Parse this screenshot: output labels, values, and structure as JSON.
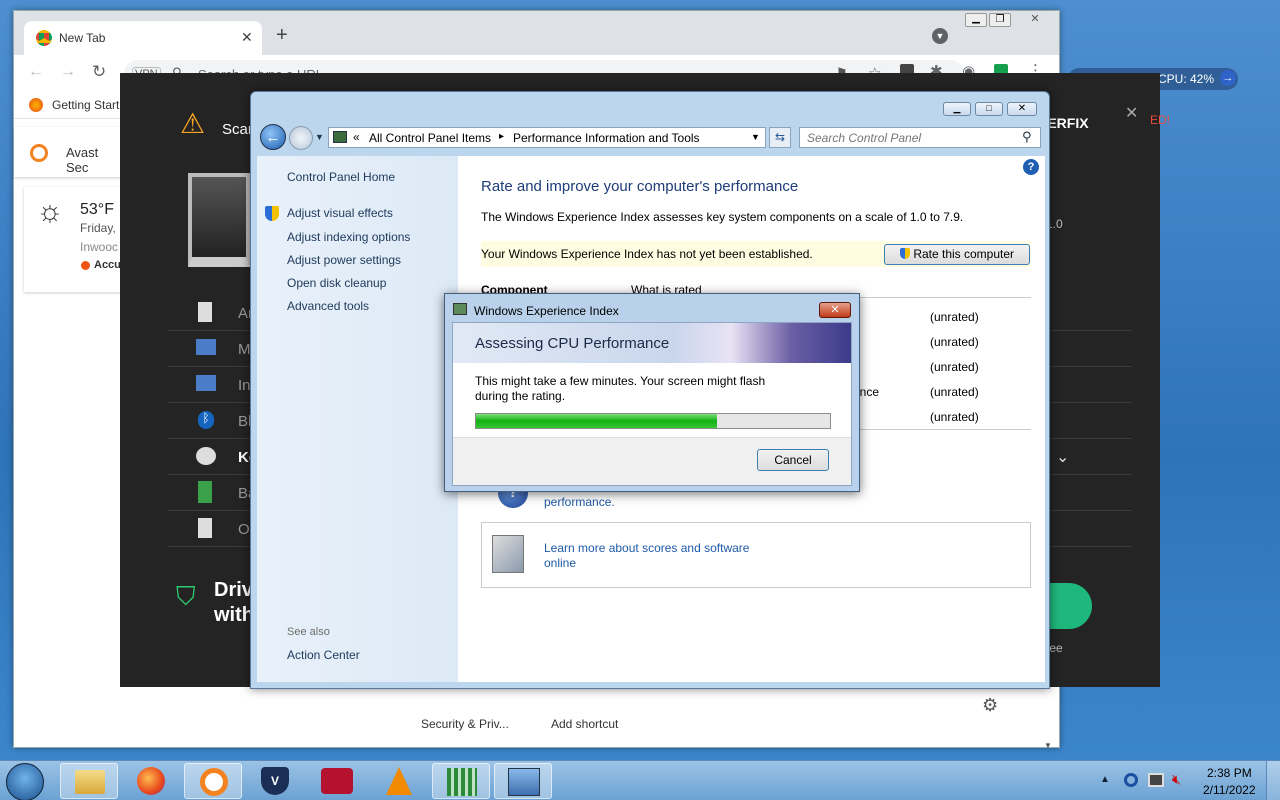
{
  "chrome": {
    "tab_title": "New Tab",
    "new_tab": "+",
    "vpn": "VPN",
    "address_placeholder": "Search or type a URL",
    "bookmark_1": "Getting Start",
    "avast_sec": "Avast Sec",
    "weather": {
      "temp": "53°F",
      "day": "Friday,",
      "city": "Inwooc",
      "source": "AccuW"
    },
    "shortcuts": [
      "Security & Priv...",
      "Add shortcut"
    ],
    "cpu": "CPU: 42%"
  },
  "avast": {
    "scan": "Scan",
    "brand": "VERFIX",
    "rows": [
      "Ar",
      "M",
      "In",
      "Bl",
      "Ke",
      "Ba",
      "O"
    ],
    "drivers_line1": "Driv",
    "drivers_line2": "with",
    "version": "1.0",
    "guarantee": "tee",
    "badge": "ED!"
  },
  "cp": {
    "breadcrumb_root": "All Control Panel Items",
    "breadcrumb_sep": "▸",
    "breadcrumb_page": "Performance Information and Tools",
    "search_placeholder": "Search Control Panel",
    "left_links": [
      "Control Panel Home",
      "Adjust visual effects",
      "Adjust indexing options",
      "Adjust power settings",
      "Open disk cleanup",
      "Advanced tools"
    ],
    "see_also": "See also",
    "action_center": "Action Center",
    "heading": "Rate and improve your computer's performance",
    "intro": "The Windows Experience Index assesses key system components on a scale of 1.0 to 7.9.",
    "notice": "Your Windows Experience Index has not yet been established.",
    "rate_button": "Rate this computer",
    "table_header": {
      "component": "Component",
      "what": "What is rated"
    },
    "rows": [
      {
        "what": "",
        "score": "(unrated)"
      },
      {
        "what": "",
        "score": "(unrated)"
      },
      {
        "what": "",
        "score": "(unrated)"
      },
      {
        "what": "ance",
        "score": "(unrated)"
      },
      {
        "what": "",
        "score": "(unrated)"
      }
    ],
    "tip_text": "performance.",
    "learn_more_1": "Learn more about scores and software",
    "learn_more_2": "online"
  },
  "dialog": {
    "title": "Windows Experience Index",
    "heading": "Assessing CPU Performance",
    "message_1": "This might take a few minutes. Your screen might flash",
    "message_2": "during the rating.",
    "progress": 0.68,
    "cancel": "Cancel"
  },
  "taskbar": {
    "time": "2:38 PM",
    "date": "2/11/2022"
  }
}
